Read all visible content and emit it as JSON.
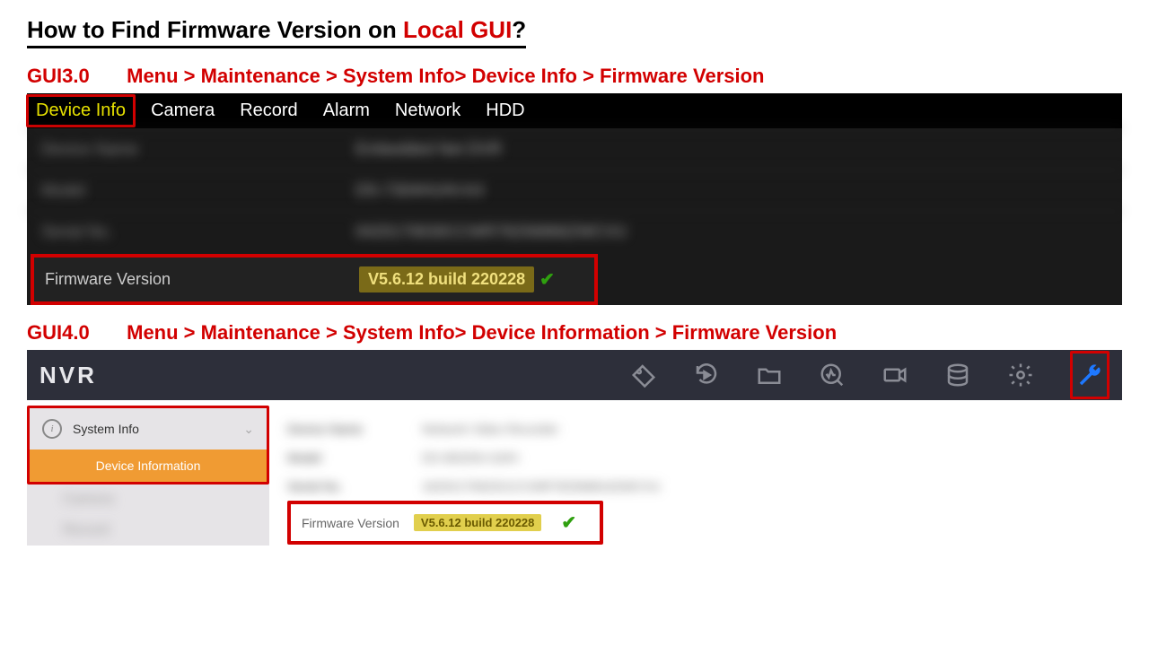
{
  "title_prefix": "How to Find Firmware Version on ",
  "title_highlight": "Local GUI",
  "title_suffix": "?",
  "gui3": {
    "tag": "GUI3.0",
    "breadcrumb": "Menu > Maintenance > System Info> Device Info > Firmware Version",
    "tabs": [
      "Device Info",
      "Camera",
      "Record",
      "Alarm",
      "Network",
      "HDD"
    ],
    "rows": [
      {
        "label": "Device Name",
        "value": "Embedded Net DVR"
      },
      {
        "label": "Model",
        "value": "DS-7304HUHI-K4"
      },
      {
        "label": "Serial No.",
        "value": "0420170630CCWR78256866ZWCVU"
      }
    ],
    "fw_label": "Firmware Version",
    "fw_value": "V5.6.12  build 220228"
  },
  "gui4": {
    "tag": "GUI4.0",
    "breadcrumb": "Menu > Maintenance > System Info> Device Information > Firmware Version",
    "logo": "NVR",
    "side_header": "System Info",
    "side_active": "Device Information",
    "side_items": [
      "Camera",
      "Record"
    ],
    "rows": [
      {
        "label": "Device Name",
        "value": "Network Video Recorder"
      },
      {
        "label": "Model",
        "value": "DS-9632NI-I16/H"
      },
      {
        "label": "Serial No.",
        "value": "1620217062021CCWR7825686162WCVU"
      }
    ],
    "fw_label": "Firmware Version",
    "fw_value": "V5.6.12  build 220228"
  }
}
